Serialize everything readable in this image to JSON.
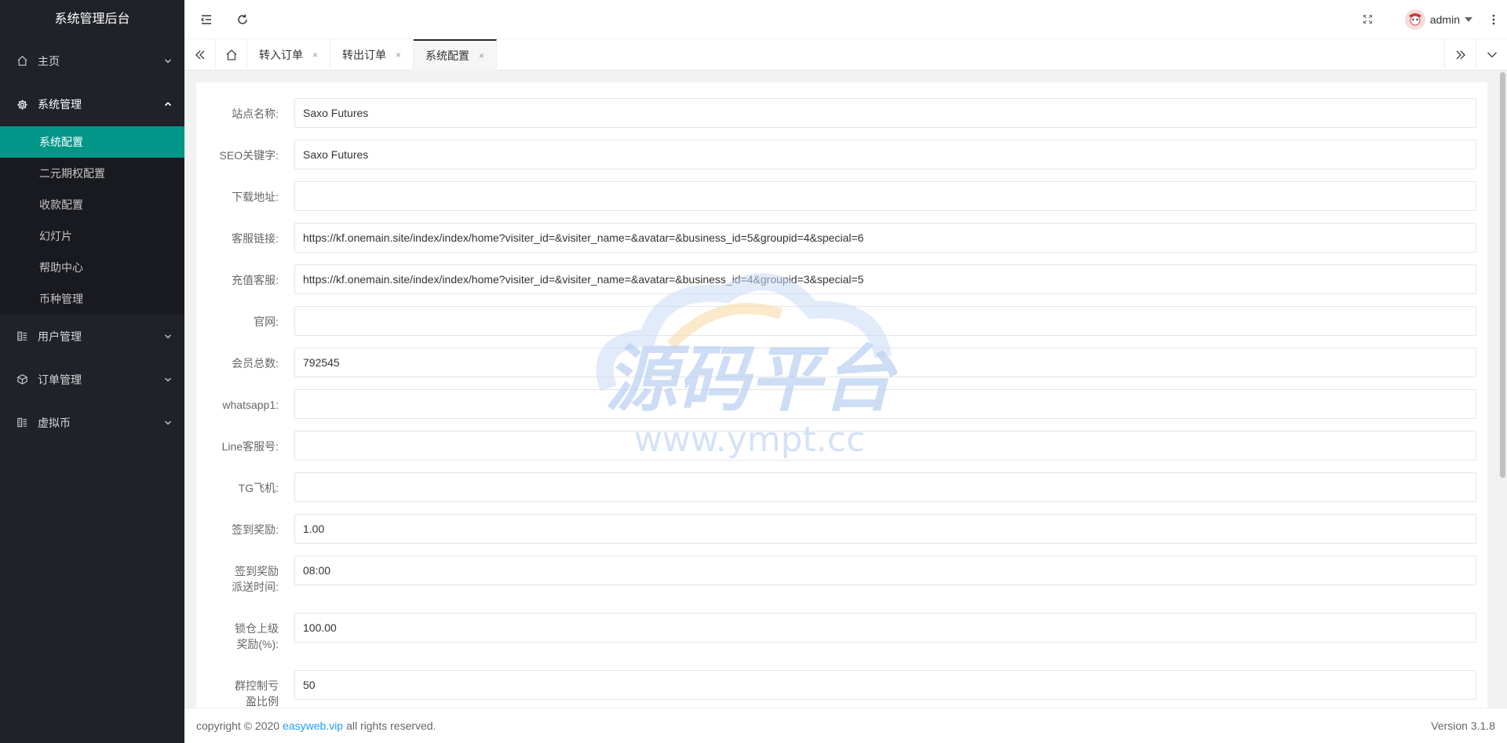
{
  "sidebar": {
    "logo": "系统管理后台",
    "items": [
      {
        "label": "主页",
        "icon": "home-icon",
        "open": false
      },
      {
        "label": "系统管理",
        "icon": "gear-icon",
        "open": true,
        "children": [
          "系统配置",
          "二元期权配置",
          "收款配置",
          "幻灯片",
          "帮助中心",
          "币种管理"
        ],
        "active_child": 0
      },
      {
        "label": "用户管理",
        "icon": "list-icon",
        "open": false
      },
      {
        "label": "订单管理",
        "icon": "cube-icon",
        "open": false
      },
      {
        "label": "虚拟币",
        "icon": "list-icon",
        "open": false
      }
    ]
  },
  "header": {
    "user": "admin",
    "icons": [
      "menu-fold-icon",
      "refresh-icon",
      "fullscreen-icon",
      "more-vertical-icon"
    ]
  },
  "tabs": {
    "items": [
      {
        "label": "转入订单",
        "active": false
      },
      {
        "label": "转出订单",
        "active": false
      },
      {
        "label": "系统配置",
        "active": true
      }
    ],
    "close_glyph": "×"
  },
  "form": {
    "fields": [
      {
        "label": "站点名称:",
        "value": "Saxo Futures"
      },
      {
        "label": "SEO关键字:",
        "value": "Saxo Futures"
      },
      {
        "label": "下载地址:",
        "value": ""
      },
      {
        "label": "客服链接:",
        "value": "https://kf.onemain.site/index/index/home?visiter_id=&visiter_name=&avatar=&business_id=5&groupid=4&special=6"
      },
      {
        "label": "充值客服:",
        "value": "https://kf.onemain.site/index/index/home?visiter_id=&visiter_name=&avatar=&business_id=4&groupid=3&special=5"
      },
      {
        "label": "官网:",
        "value": ""
      },
      {
        "label": "会员总数:",
        "value": "792545"
      },
      {
        "label": "whatsapp1:",
        "value": ""
      },
      {
        "label": "Line客服号:",
        "value": ""
      },
      {
        "label": "TG飞机:",
        "value": ""
      },
      {
        "label": "签到奖励:",
        "value": "1.00"
      },
      {
        "label": "签到奖励派送时间:",
        "value": "08:00"
      },
      {
        "label": "锁仓上级奖励(%):",
        "value": "100.00"
      },
      {
        "label": "群控制亏盈比例(%):",
        "value": "50"
      }
    ]
  },
  "watermark": {
    "title": "源码平台",
    "url": "www.ympt.cc"
  },
  "footer": {
    "copyright_prefix": "copyright © 2020",
    "link": "easyweb.vip",
    "copyright_suffix": "all rights reserved.",
    "version": "Version 3.1.8"
  },
  "colors": {
    "sidebar_bg": "#20222a",
    "active_green": "#009688",
    "link_blue": "#1e9fff"
  }
}
